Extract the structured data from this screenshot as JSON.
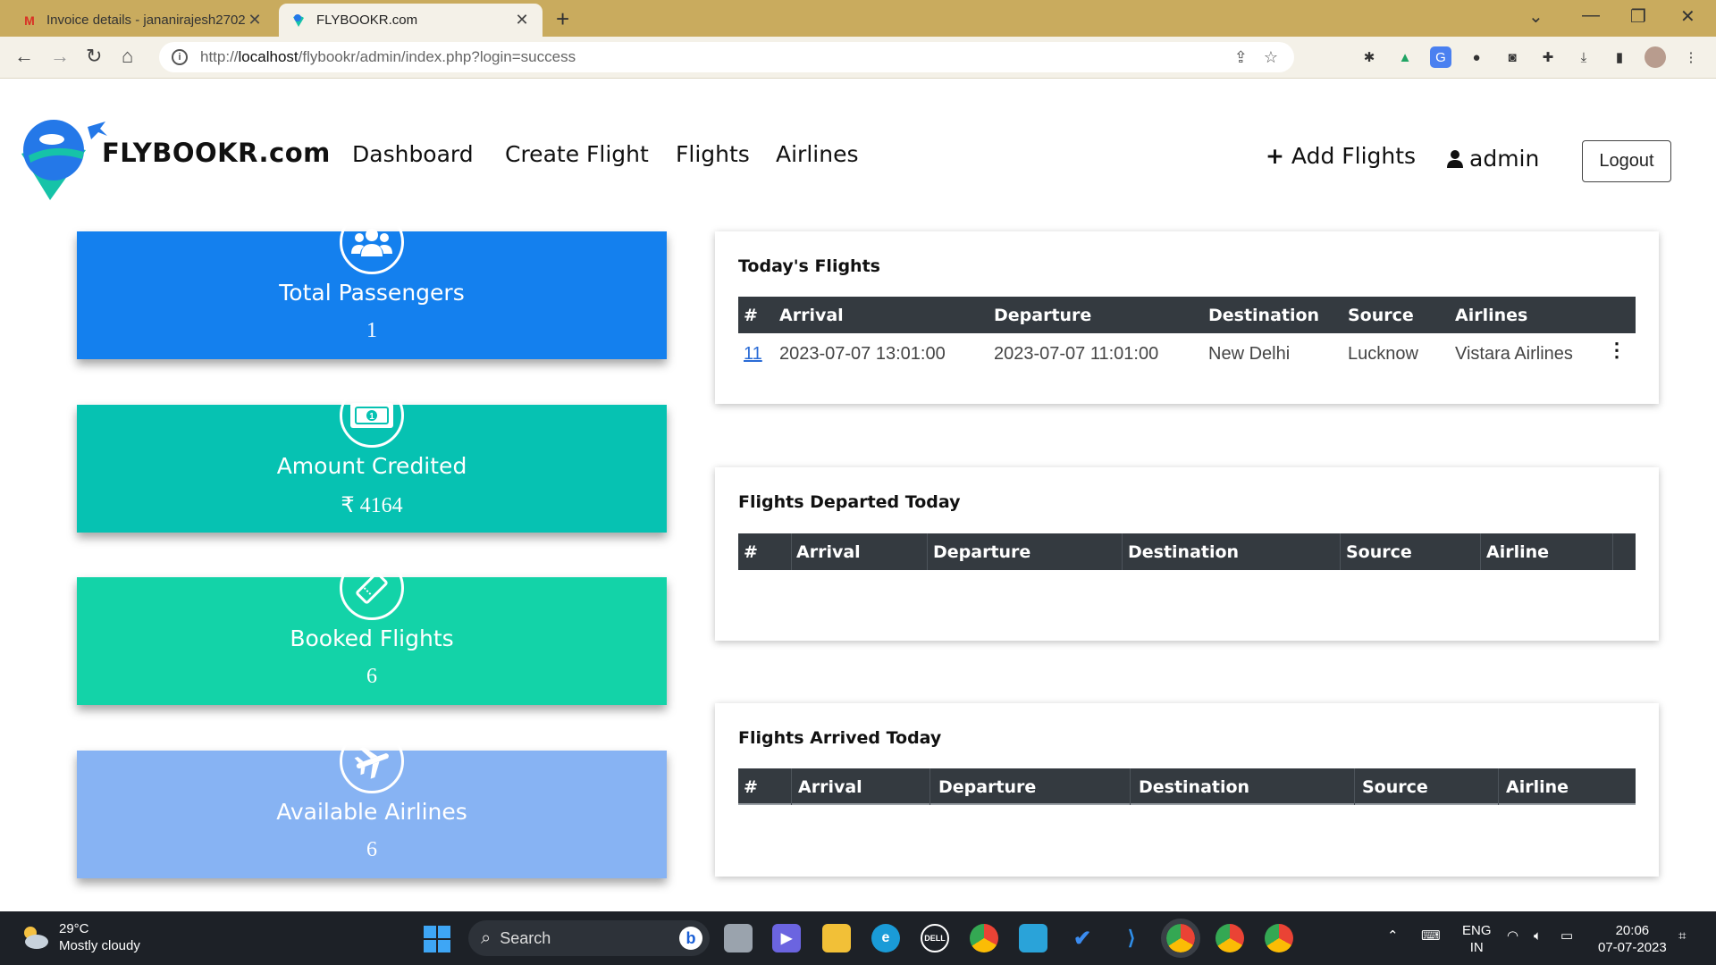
{
  "browser": {
    "tabs": [
      {
        "title": "Invoice details - jananirajesh2702",
        "active": false
      },
      {
        "title": "FLYBOOKR.com",
        "active": true
      }
    ],
    "url_prefix": "http://",
    "url_host": "localhost",
    "url_path": "/flybookr/admin/index.php?login=success"
  },
  "site": {
    "brand": "FLYBOOKR.com",
    "nav": [
      "Dashboard",
      "Create Flight",
      "Flights",
      "Airlines"
    ],
    "add_flights": "Add Flights",
    "user": "admin",
    "logout": "Logout"
  },
  "stats": [
    {
      "label": "Total Passengers",
      "value": "1",
      "color": "#1480ee",
      "icon": "users-icon"
    },
    {
      "label": "Amount Credited",
      "value": "₹ 4164",
      "color": "#06c2b2",
      "icon": "money-bill-icon"
    },
    {
      "label": "Booked Flights",
      "value": "6",
      "color": "#13d3a8",
      "icon": "ticket-icon"
    },
    {
      "label": "Available Airlines",
      "value": "6",
      "color": "#87b3f3",
      "icon": "plane-icon"
    }
  ],
  "todays_flights": {
    "title": "Today's Flights",
    "headers": [
      "#",
      "Arrival",
      "Departure",
      "Destination",
      "Source",
      "Airlines"
    ],
    "rows": [
      {
        "id": "11",
        "arrival": "2023-07-07 13:01:00",
        "departure": "2023-07-07 11:01:00",
        "destination": "New Delhi",
        "source": "Lucknow",
        "airline": "Vistara Airlines"
      }
    ]
  },
  "departed_today": {
    "title": "Flights Departed Today",
    "headers": [
      "#",
      "Arrival",
      "Departure",
      "Destination",
      "Source",
      "Airline"
    ]
  },
  "arrived_today": {
    "title": "Flights Arrived Today",
    "headers": [
      "#",
      "Arrival",
      "Departure",
      "Destination",
      "Source",
      "Airline"
    ]
  },
  "taskbar": {
    "weather_temp": "29°C",
    "weather_desc": "Mostly cloudy",
    "search": "Search",
    "lang_top": "ENG",
    "lang_bottom": "IN",
    "time": "20:06",
    "date": "07-07-2023"
  }
}
